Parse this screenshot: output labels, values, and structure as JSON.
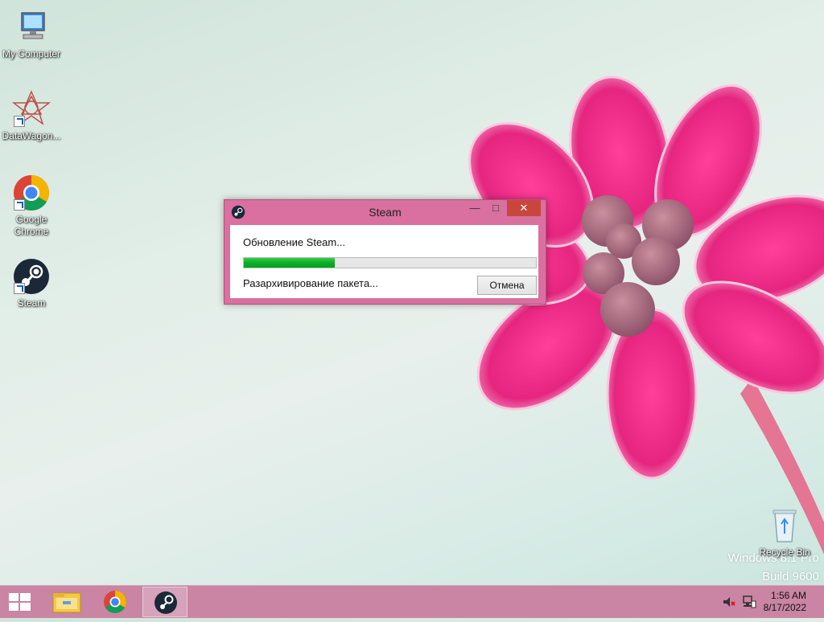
{
  "desktop": {
    "icons": [
      {
        "label": "My Computer"
      },
      {
        "label": "DataWagon..."
      },
      {
        "label": "Google Chrome"
      },
      {
        "label": "Steam"
      },
      {
        "label": "Recycle Bin"
      }
    ],
    "watermark": {
      "line1": "Windows 8.1 Pro",
      "line2": "Build 9600"
    }
  },
  "dialog": {
    "title": "Steam",
    "status_primary": "Обновление Steam...",
    "status_secondary": "Разархивирование пакета...",
    "progress_fraction": 0.31,
    "cancel_label": "Отмена",
    "minimize_glyph": "—",
    "maximize_glyph": "□",
    "close_glyph": "✕"
  },
  "taskbar": {
    "apps": [
      "file-explorer-icon",
      "chrome-icon",
      "steam-icon"
    ],
    "active_app": "steam-icon",
    "clock": {
      "time": "1:56 AM",
      "date": "8/17/2022"
    }
  },
  "colors": {
    "accent": "#d9709f",
    "taskbar": "#c985a3",
    "progress": "#06b025",
    "close": "#c9463d"
  }
}
